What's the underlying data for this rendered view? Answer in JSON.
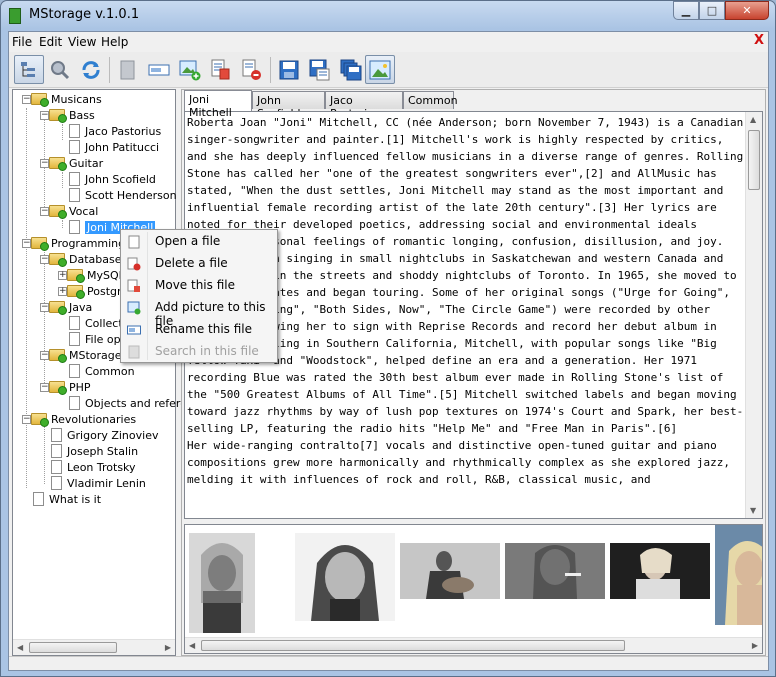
{
  "window": {
    "title": "MStorage v.1.0.1",
    "controls": {
      "minimize": "▁",
      "maximize": "□",
      "close": "✕"
    }
  },
  "menubar": {
    "items": [
      "File",
      "Edit",
      "View",
      "Help"
    ],
    "close_label": "X"
  },
  "toolbar": {
    "buttons": [
      "tree-view-icon",
      "search-icon",
      "refresh-icon",
      "document-icon",
      "rename-icon",
      "add-picture-icon",
      "move-file-icon",
      "delete-file-icon",
      "save-icon",
      "save-as-icon",
      "save-all-icon",
      "picture-view-icon"
    ]
  },
  "tree": {
    "root_musicans": "Musicans",
    "bass": "Bass",
    "jaco": "Jaco Pastorius",
    "john_patitucci": "John Patitucci",
    "guitar": "Guitar",
    "john_scofield": "John Scofield",
    "scott": "Scott Henderson",
    "vocal": "Vocal",
    "joni": "Joni Mitchell",
    "programming": "Programming",
    "databases": "Databases",
    "mysql": "MySQL",
    "postgre": "PostgreSQL",
    "java": "Java",
    "collections": "Collections",
    "file_ops": "File operations",
    "mstorage": "MStorage",
    "common": "Common",
    "php": "PHP",
    "objects": "Objects and references",
    "revolutionaries": "Revolutionaries",
    "zinoviev": "Grigory Zinoviev",
    "stalin": "Joseph Stalin",
    "trotsky": "Leon Trotsky",
    "lenin": "Vladimir Lenin",
    "what_is_it": "What is it"
  },
  "tabs": [
    "Joni Mitchell",
    "John Scofield",
    "Jaco Pastorius",
    "Common"
  ],
  "content": {
    "text": "Roberta Joan \"Joni\" Mitchell, CC (née Anderson; born November 7, 1943) is a Canadian singer-songwriter and painter.[1] Mitchell's work is highly respected by critics, and she has deeply influenced fellow musicians in a diverse range of genres. Rolling Stone has called her \"one of the greatest songwriters ever\",[2] and AllMusic has stated, \"When the dust settles, Joni Mitchell may stand as the most important and influential female recording artist of the late 20th century\".[3] Her lyrics are noted for their developed poetics, addressing social and environmental ideals alongside personal feelings of romantic longing, confusion, disillusion, and joy.\nMitchell began singing in small nightclubs in Saskatchewan and western Canada and then busking in the streets and shoddy nightclubs of Toronto. In 1965, she moved to the United States and began touring. Some of her original songs (\"Urge for Going\", \"Chelsea Morning\", \"Both Sides, Now\", \"The Circle Game\") were recorded by other singers, allowing her to sign with Reprise Records and record her debut album in 1968.[4] Settling in Southern California, Mitchell, with popular songs like \"Big Yellow Taxi\" and \"Woodstock\", helped define an era and a generation. Her 1971 recording Blue was rated the 30th best album ever made in Rolling Stone's list of the \"500 Greatest Albums of All Time\".[5] Mitchell switched labels and began moving toward jazz rhythms by way of lush pop textures on 1974's Court and Spark, her best-selling LP, featuring the radio hits \"Help Me\" and \"Free Man in Paris\".[6]\nHer wide-ranging contralto[7] vocals and distinctive open-tuned guitar and piano compositions grew more harmonically and rhythmically complex as she explored jazz, melding it with influences of rock and roll, R&B, classical music, and"
  },
  "context_menu": {
    "items": [
      {
        "label": "Open a file",
        "icon": "open-file-icon",
        "enabled": true
      },
      {
        "label": "Delete a file",
        "icon": "delete-file-icon",
        "enabled": true
      },
      {
        "label": "Move this file",
        "icon": "move-file-icon",
        "enabled": true
      },
      {
        "label": "Add picture to this file",
        "icon": "add-picture-icon",
        "enabled": true
      },
      {
        "label": "Rename this file",
        "icon": "rename-icon",
        "enabled": true
      },
      {
        "label": "Search in this file",
        "icon": "search-file-icon",
        "enabled": false
      }
    ]
  }
}
